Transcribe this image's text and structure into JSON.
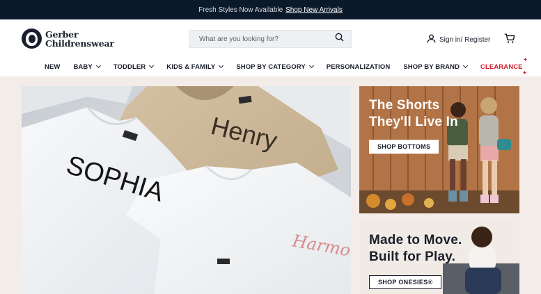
{
  "promo": {
    "text": "Fresh Styles Now Available",
    "link": "Shop New Arrivals"
  },
  "header": {
    "logo_line1": "Gerber",
    "logo_line2": "Childrenswear",
    "search_placeholder": "What are you looking for?",
    "signin_label": "Sign in/ Register"
  },
  "nav": {
    "items": [
      {
        "label": "NEW"
      },
      {
        "label": "BABY"
      },
      {
        "label": "TODDLER"
      },
      {
        "label": "KIDS & FAMILY"
      },
      {
        "label": "SHOP BY CATEGORY"
      },
      {
        "label": "PERSONALIZATION"
      },
      {
        "label": "SHOP BY BRAND"
      },
      {
        "label": "CLEARANCE"
      }
    ]
  },
  "hero": {
    "names": [
      "SOPHIA",
      "Henry",
      "Harmon"
    ],
    "tag_text": "Gerber"
  },
  "promos": [
    {
      "title_line1": "The Shorts",
      "title_line2": "They'll Live In",
      "button": "SHOP BOTTOMS"
    },
    {
      "title_line1": "Made to Move.",
      "title_line2": "Built for Play.",
      "button": "SHOP ONESIES®"
    }
  ],
  "colors": {
    "promo_bg": "#0b1a2b",
    "accent_clearance": "#d01c2c",
    "brand_navy": "#1a1f2c"
  }
}
